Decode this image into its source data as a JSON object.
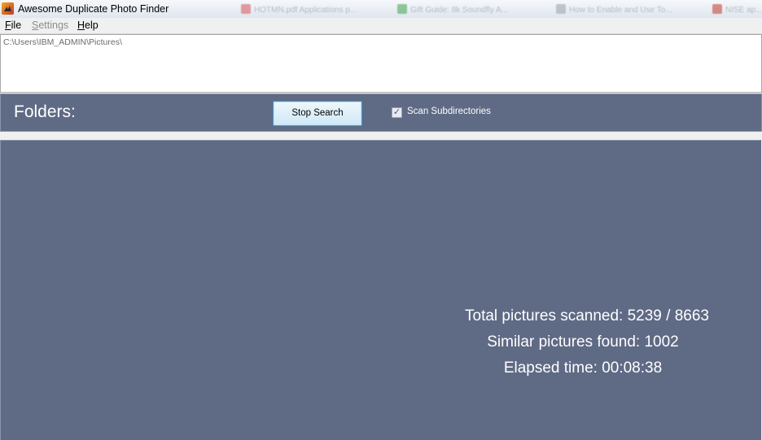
{
  "window": {
    "title": "Awesome Duplicate Photo Finder",
    "background_tabs": [
      {
        "label": "HOTMN.pdf Applications p...",
        "color": "#d9535a"
      },
      {
        "label": "Gift Guide: 8k Soundfly A...",
        "color": "#3fa34d"
      },
      {
        "label": "How to Enable and Use To...",
        "color": "#9aa0a8"
      },
      {
        "label": "NISE ap...",
        "color": "#c0392b"
      }
    ]
  },
  "menu": {
    "file": "File",
    "settings": "Settings",
    "help": "Help"
  },
  "folders": {
    "path": "C:\\Users\\IBM_ADMIN\\Pictures\\"
  },
  "toolbar": {
    "folders_label": "Folders:",
    "stop_search_label": "Stop Search",
    "scan_subdirectories_label": "Scan Subdirectories",
    "scan_subdirectories_checked": true
  },
  "status": {
    "total_scanned": "Total pictures scanned: 5239 / 8663",
    "similar_found": "Similar pictures found: 1002",
    "elapsed_time": "Elapsed time: 00:08:38"
  },
  "colors": {
    "panel": "#5f6a85",
    "button_border": "#3c9ad6"
  }
}
